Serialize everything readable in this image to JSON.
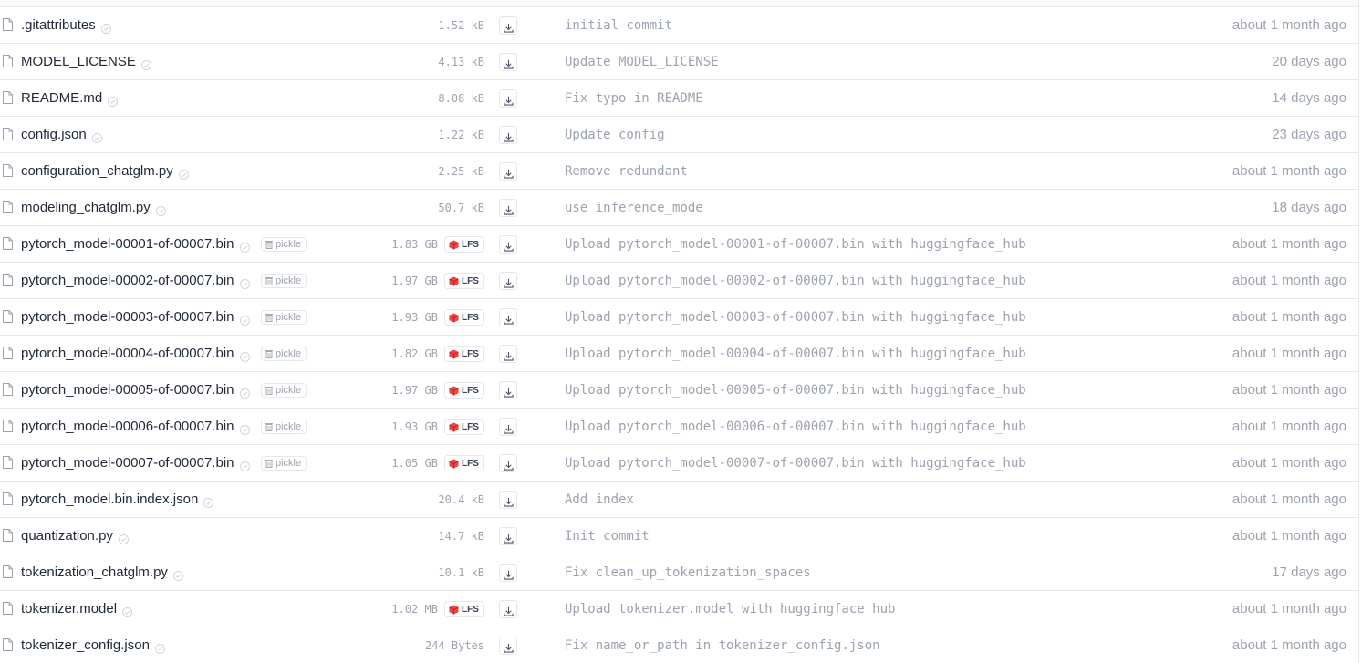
{
  "files": [
    {
      "name": ".gitattributes",
      "size": "1.52 kB",
      "lfs": false,
      "pickle": false,
      "commit": "initial commit",
      "date": "about 1 month ago"
    },
    {
      "name": "MODEL_LICENSE",
      "size": "4.13 kB",
      "lfs": false,
      "pickle": false,
      "commit": "Update MODEL_LICENSE",
      "date": "20 days ago"
    },
    {
      "name": "README.md",
      "size": "8.08 kB",
      "lfs": false,
      "pickle": false,
      "commit": "Fix typo in README",
      "date": "14 days ago"
    },
    {
      "name": "config.json",
      "size": "1.22 kB",
      "lfs": false,
      "pickle": false,
      "commit": "Update config",
      "date": "23 days ago"
    },
    {
      "name": "configuration_chatglm.py",
      "size": "2.25 kB",
      "lfs": false,
      "pickle": false,
      "commit": "Remove redundant",
      "date": "about 1 month ago"
    },
    {
      "name": "modeling_chatglm.py",
      "size": "50.7 kB",
      "lfs": false,
      "pickle": false,
      "commit": "use inference_mode",
      "date": "18 days ago"
    },
    {
      "name": "pytorch_model-00001-of-00007.bin",
      "size": "1.83 GB",
      "lfs": true,
      "pickle": true,
      "commit": "Upload pytorch_model-00001-of-00007.bin with huggingface_hub",
      "date": "about 1 month ago"
    },
    {
      "name": "pytorch_model-00002-of-00007.bin",
      "size": "1.97 GB",
      "lfs": true,
      "pickle": true,
      "commit": "Upload pytorch_model-00002-of-00007.bin with huggingface_hub",
      "date": "about 1 month ago"
    },
    {
      "name": "pytorch_model-00003-of-00007.bin",
      "size": "1.93 GB",
      "lfs": true,
      "pickle": true,
      "commit": "Upload pytorch_model-00003-of-00007.bin with huggingface_hub",
      "date": "about 1 month ago"
    },
    {
      "name": "pytorch_model-00004-of-00007.bin",
      "size": "1.82 GB",
      "lfs": true,
      "pickle": true,
      "commit": "Upload pytorch_model-00004-of-00007.bin with huggingface_hub",
      "date": "about 1 month ago"
    },
    {
      "name": "pytorch_model-00005-of-00007.bin",
      "size": "1.97 GB",
      "lfs": true,
      "pickle": true,
      "commit": "Upload pytorch_model-00005-of-00007.bin with huggingface_hub",
      "date": "about 1 month ago"
    },
    {
      "name": "pytorch_model-00006-of-00007.bin",
      "size": "1.93 GB",
      "lfs": true,
      "pickle": true,
      "commit": "Upload pytorch_model-00006-of-00007.bin with huggingface_hub",
      "date": "about 1 month ago"
    },
    {
      "name": "pytorch_model-00007-of-00007.bin",
      "size": "1.05 GB",
      "lfs": true,
      "pickle": true,
      "commit": "Upload pytorch_model-00007-of-00007.bin with huggingface_hub",
      "date": "about 1 month ago"
    },
    {
      "name": "pytorch_model.bin.index.json",
      "size": "20.4 kB",
      "lfs": false,
      "pickle": false,
      "commit": "Add index",
      "date": "about 1 month ago"
    },
    {
      "name": "quantization.py",
      "size": "14.7 kB",
      "lfs": false,
      "pickle": false,
      "commit": "Init commit",
      "date": "about 1 month ago"
    },
    {
      "name": "tokenization_chatglm.py",
      "size": "10.1 kB",
      "lfs": false,
      "pickle": false,
      "commit": "Fix clean_up_tokenization_spaces",
      "date": "17 days ago"
    },
    {
      "name": "tokenizer.model",
      "size": "1.02 MB",
      "lfs": true,
      "pickle": false,
      "commit": "Upload tokenizer.model with huggingface_hub",
      "date": "about 1 month ago"
    },
    {
      "name": "tokenizer_config.json",
      "size": "244 Bytes",
      "lfs": false,
      "pickle": false,
      "commit": "Fix name_or_path in tokenizer_config.json",
      "date": "about 1 month ago"
    }
  ],
  "labels": {
    "pickle": "pickle",
    "lfs": "LFS"
  },
  "icons": {
    "file": "file-icon",
    "safe": "shield-check-icon",
    "pickle": "trash-icon",
    "lfs": "lfs-cube-icon",
    "download": "download-icon"
  },
  "colors": {
    "lfs_accent": "#ef4444",
    "muted_text": "#9ca3af",
    "border": "#e5e7eb"
  }
}
